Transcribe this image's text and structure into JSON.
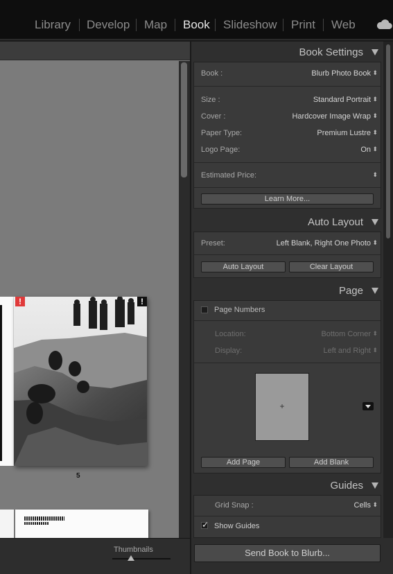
{
  "modules": [
    "Library",
    "Develop",
    "Map",
    "Book",
    "Slideshow",
    "Print",
    "Web"
  ],
  "active_module": "Book",
  "canvas": {
    "page_number": "5",
    "thumbnails_label": "Thumbnails",
    "thumbnail_size": 0.3
  },
  "book_settings": {
    "title": "Book Settings",
    "book_label": "Book :",
    "book_value": "Blurb Photo Book",
    "size_label": "Size :",
    "size_value": "Standard Portrait",
    "cover_label": "Cover :",
    "cover_value": "Hardcover Image Wrap",
    "paper_label": "Paper Type:",
    "paper_value": "Premium Lustre",
    "logo_label": "Logo Page:",
    "logo_value": "On",
    "price_label": "Estimated Price:",
    "price_value": "",
    "learn_more": "Learn More..."
  },
  "auto_layout": {
    "title": "Auto Layout",
    "preset_label": "Preset:",
    "preset_value": "Left Blank, Right One Photo",
    "auto_layout_btn": "Auto Layout",
    "clear_layout_btn": "Clear Layout"
  },
  "page": {
    "title": "Page",
    "page_numbers_label": "Page Numbers",
    "page_numbers_checked": false,
    "location_label": "Location:",
    "location_value": "Bottom Corner",
    "display_label": "Display:",
    "display_value": "Left and Right",
    "add_page": "Add Page",
    "add_blank": "Add Blank",
    "plus": "+"
  },
  "guides": {
    "title": "Guides",
    "grid_snap_label": "Grid Snap :",
    "grid_snap_value": "Cells",
    "show_guides_label": "Show Guides",
    "show_guides_checked": true
  },
  "send_button": "Send Book to Blurb...",
  "colors": {
    "warning": "#e03a3a",
    "panel_bg": "#3a3a3a"
  },
  "icons": [
    "cloud-icon",
    "collapse-triangle-icon",
    "warning-icon",
    "updown-arrow-icon",
    "dropdown-icon"
  ]
}
